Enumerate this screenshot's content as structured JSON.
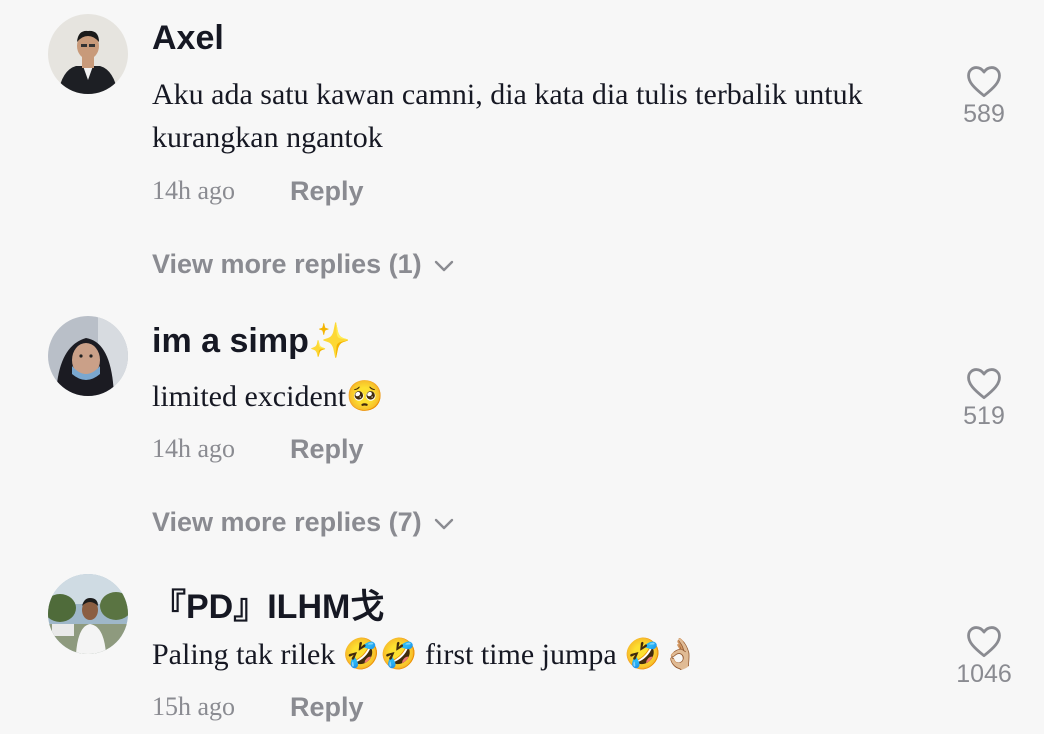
{
  "comments": [
    {
      "username": "Axel",
      "text": "Aku ada satu kawan camni, dia kata dia tulis terbalik untuk kurangkan ngantok",
      "time": "14h ago",
      "reply_label": "Reply",
      "likes": "589",
      "view_more": "View more replies (1)"
    },
    {
      "username": "im a simp✨",
      "text": "limited excident🥺",
      "time": "14h ago",
      "reply_label": "Reply",
      "likes": "519",
      "view_more": "View more replies (7)"
    },
    {
      "username": "『PD』ILHM戈",
      "text": "Paling tak rilek 🤣🤣 first time jumpa 🤣👌🏼",
      "time": "15h ago",
      "reply_label": "Reply",
      "likes": "1046"
    }
  ],
  "colors": {
    "background": "#f7f7f7",
    "primary_text": "#161823",
    "secondary_text": "#8a8b91"
  },
  "icons": [
    "heart-outline-icon",
    "chevron-down-icon"
  ]
}
